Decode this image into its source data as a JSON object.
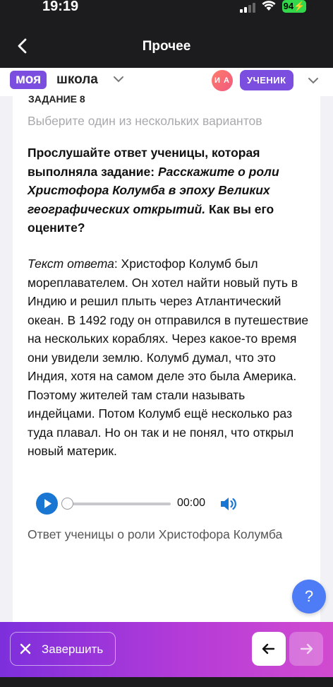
{
  "status_bar": {
    "time": "19:19",
    "battery": "94"
  },
  "nav": {
    "title": "Прочее"
  },
  "app_header": {
    "logo_part1": "моя",
    "logo_part2": "школа",
    "avatar_initials": "И А",
    "role": "УЧЕНИК"
  },
  "task": {
    "number": "ЗАДАНИЕ 8",
    "hint": "Выберите один из нескольких вариантов",
    "question_prefix": "Прослушайте ответ ученицы, которая выполняла задание: ",
    "question_topic": "Расскажите о роли Христофора Колумба в эпоху Великих географических открытий.",
    "question_suffix": " Как вы его оцените?",
    "answer_label": "Текст ответа",
    "answer_text": ": Христофор Колумб был мореплавателем. Он хотел найти новый путь в Индию и решил плыть через Атлантический океан. В 1492 году он отправился в путешествие на нескольких кораблях. Через какое-то время они увидели землю. Колумб думал, что это Индия, хотя на самом деле это была Америка. Поэтому жителей там стали называть индейцами. Потом Колумб ещё несколько раз туда плавал. Но он так и не понял, что открыл новый материк."
  },
  "audio": {
    "time": "00:00",
    "progress": 0,
    "caption": "Ответ ученицы о роли Христофора Колумба"
  },
  "help": {
    "label": "?"
  },
  "bottom_bar": {
    "finish_label": "Завершить",
    "prev_arrow": "←",
    "next_arrow": "→"
  },
  "colors": {
    "accent": "#7b4ee0",
    "play": "#1976d2",
    "help": "#4d7cf6",
    "battery": "#32d74b"
  }
}
